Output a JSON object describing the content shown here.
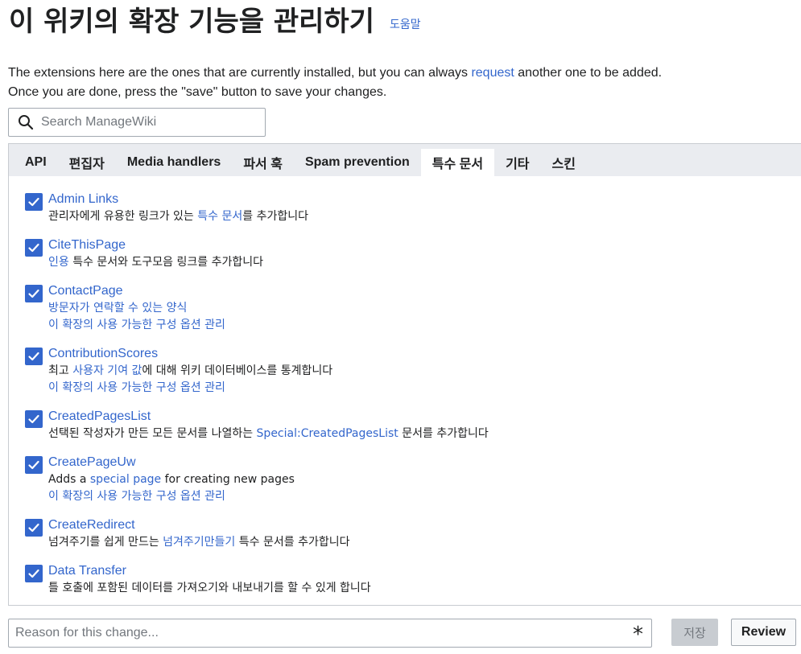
{
  "page": {
    "title": "이 위키의 확장 기능을 관리하기",
    "help_link": "도움말"
  },
  "intro": {
    "line1_before": "The extensions here are the ones that are currently installed, but you can always ",
    "line1_link": "request",
    "line1_after": " another one to be added.",
    "line2": "Once you are done, press the \"save\" button to save your changes."
  },
  "search": {
    "placeholder": "Search ManageWiki",
    "value": "",
    "icon": "search-icon"
  },
  "tabs": [
    {
      "label": "API",
      "active": false
    },
    {
      "label": "편집자",
      "active": false
    },
    {
      "label": "Media handlers",
      "active": false
    },
    {
      "label": "파서 훅",
      "active": false
    },
    {
      "label": "Spam prevention",
      "active": false
    },
    {
      "label": "특수 문서",
      "active": true
    },
    {
      "label": "기타",
      "active": false
    },
    {
      "label": "스킨",
      "active": false
    }
  ],
  "extensions": [
    {
      "name": "Admin Links",
      "checked": true,
      "desc": [
        {
          "t": "관리자에게 유용한 링크가 있는 "
        },
        {
          "t": "특수 문서",
          "link": true
        },
        {
          "t": "를 추가합니다"
        }
      ],
      "config": ""
    },
    {
      "name": "CiteThisPage",
      "checked": true,
      "desc": [
        {
          "t": "인용",
          "link": true
        },
        {
          "t": " 특수 문서와 도구모음 링크를 추가합니다"
        }
      ],
      "config": ""
    },
    {
      "name": "ContactPage",
      "checked": true,
      "desc": [
        {
          "t": "방문자가 연락할 수 있는 양식",
          "link": true
        }
      ],
      "config": "이 확장의 사용 가능한 구성 옵션 관리"
    },
    {
      "name": "ContributionScores",
      "checked": true,
      "desc": [
        {
          "t": "최고 "
        },
        {
          "t": "사용자 기여 값",
          "link": true
        },
        {
          "t": "에 대해 위키 데이터베이스를 통계합니다"
        }
      ],
      "config": "이 확장의 사용 가능한 구성 옵션 관리"
    },
    {
      "name": "CreatedPagesList",
      "checked": true,
      "desc": [
        {
          "t": "선택된 작성자가 만든 모든 문서를 나열하는 "
        },
        {
          "t": "Special:CreatedPagesList",
          "link": true
        },
        {
          "t": " 문서를 추가합니다"
        }
      ],
      "config": ""
    },
    {
      "name": "CreatePageUw",
      "checked": true,
      "desc": [
        {
          "t": "Adds a "
        },
        {
          "t": "special page",
          "link": true
        },
        {
          "t": " for creating new pages"
        }
      ],
      "config": "이 확장의 사용 가능한 구성 옵션 관리"
    },
    {
      "name": "CreateRedirect",
      "checked": true,
      "desc": [
        {
          "t": "넘겨주기를 쉽게 만드는 "
        },
        {
          "t": "넘겨주기만들기",
          "link": true
        },
        {
          "t": " 특수 문서를 추가합니다"
        }
      ],
      "config": ""
    },
    {
      "name": "Data Transfer",
      "checked": true,
      "desc": [
        {
          "t": "틀 호출에 포함된 데이터를 가져오기와 내보내기를 할 수 있게 합니다"
        }
      ],
      "config": ""
    }
  ],
  "footer": {
    "reason_placeholder": "Reason for this change...",
    "reason_value": "",
    "required_mark": "*",
    "save_label": "저장",
    "review_label": "Review"
  },
  "colors": {
    "accent": "#3366cc",
    "tab_bar": "#eaecf0",
    "disabled_button": "#c8ccd1"
  }
}
